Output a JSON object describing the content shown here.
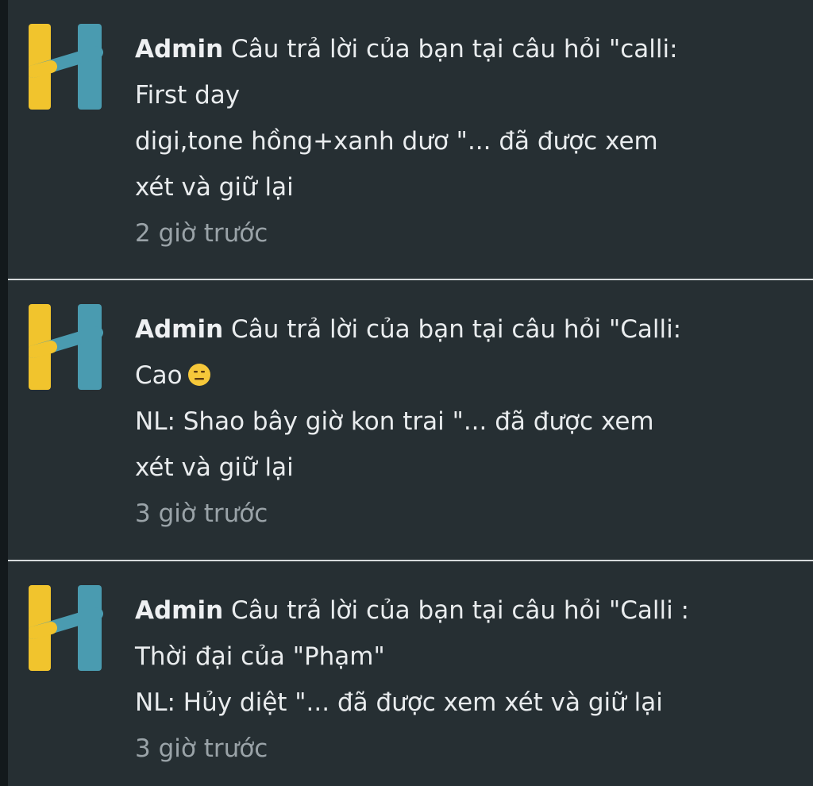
{
  "notifications": [
    {
      "author": "Admin",
      "lines": [
        "Câu trả lời của bạn tại câu hỏi \"calli:",
        "First day",
        "digi,tone hồng+xanh dươ \"... đã được xem",
        "xét và giữ lại"
      ],
      "time": "2 giờ trước",
      "logo_icon": "h-logo-icon"
    },
    {
      "author": "Admin",
      "lines": [
        "Câu trả lời của bạn tại câu hỏi \"Calli:",
        "Cao",
        "NL: Shao bây giờ kon trai  \"... đã được xem",
        "xét và giữ lại"
      ],
      "emoji": "expressionless-face-icon",
      "time": "3 giờ trước",
      "logo_icon": "h-logo-icon"
    },
    {
      "author": "Admin",
      "lines": [
        "Câu trả lời của bạn tại câu hỏi \"Calli :",
        "Thời đại của \"Phạm\"",
        "NL: Hủy diệt \"... đã được xem xét và giữ lại"
      ],
      "time": "3 giờ trước",
      "logo_icon": "h-logo-icon"
    }
  ],
  "colors": {
    "background": "#262f33",
    "divider": "#d6dadc",
    "text": "#e9ecee",
    "time_text": "#9aa3a8",
    "logo_yellow": "#f1c42d",
    "logo_blue": "#4a9bb0"
  }
}
